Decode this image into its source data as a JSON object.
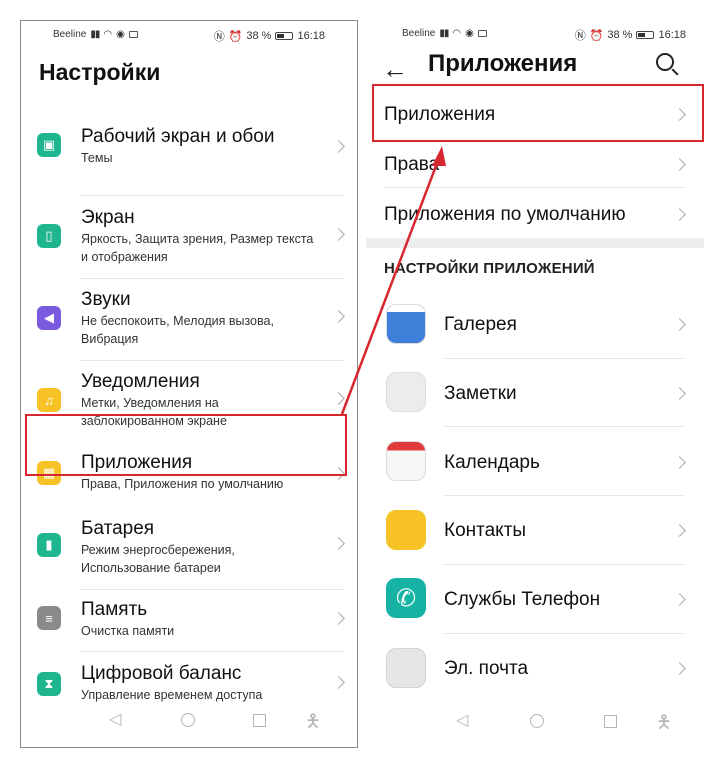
{
  "left": {
    "status": {
      "carrier": "Beeline",
      "battery": "38 %",
      "time": "16:18"
    },
    "title": "Настройки",
    "items": [
      {
        "title": "Рабочий экран и обои",
        "sub": "Темы",
        "icon": "image-icon",
        "color": "#1fb58f"
      },
      {
        "title": "Экран",
        "sub": "Яркость, Защита зрения, Размер текста и отображения",
        "icon": "phone-screen-icon",
        "color": "#1fb58f"
      },
      {
        "title": "Звуки",
        "sub": "Не беспокоить, Мелодия вызова, Вибрация",
        "icon": "speaker-icon",
        "color": "#7a5be0"
      },
      {
        "title": "Уведомления",
        "sub": "Метки, Уведомления на заблокированном экране",
        "icon": "bell-icon",
        "color": "#f6c225"
      },
      {
        "title": "Приложения",
        "sub": "Права, Приложения по умолчанию",
        "icon": "apps-grid-icon",
        "color": "#f6c225"
      },
      {
        "title": "Батарея",
        "sub": "Режим энергосбережения, Использование батареи",
        "icon": "battery-icon",
        "color": "#1fb58f"
      },
      {
        "title": "Память",
        "sub": "Очистка памяти",
        "icon": "storage-icon",
        "color": "#8a8a8a"
      },
      {
        "title": "Цифровой баланс",
        "sub": "Управление временем доступа",
        "icon": "hourglass-icon",
        "color": "#1fb58f"
      }
    ]
  },
  "right": {
    "status": {
      "carrier": "Beeline",
      "battery": "38 %",
      "time": "16:18"
    },
    "title": "Приложения",
    "top_rows": [
      "Приложения",
      "Права",
      "Приложения по умолчанию"
    ],
    "section_header": "НАСТРОЙКИ ПРИЛОЖЕНИЙ",
    "apps": [
      {
        "label": "Галерея",
        "icon": "gallery-icon",
        "color": "#3d7fd9"
      },
      {
        "label": "Заметки",
        "icon": "notes-icon",
        "color": "#e7e7e7"
      },
      {
        "label": "Календарь",
        "icon": "calendar-icon",
        "color": "#e13a3a"
      },
      {
        "label": "Контакты",
        "icon": "contacts-icon",
        "color": "#f6c225"
      },
      {
        "label": "Службы Телефон",
        "icon": "phone-icon",
        "color": "#16b3a5"
      },
      {
        "label": "Эл. почта",
        "icon": "mail-icon",
        "color": "#e0e0e0"
      }
    ]
  },
  "colors": {
    "highlight": "#d6282e"
  }
}
